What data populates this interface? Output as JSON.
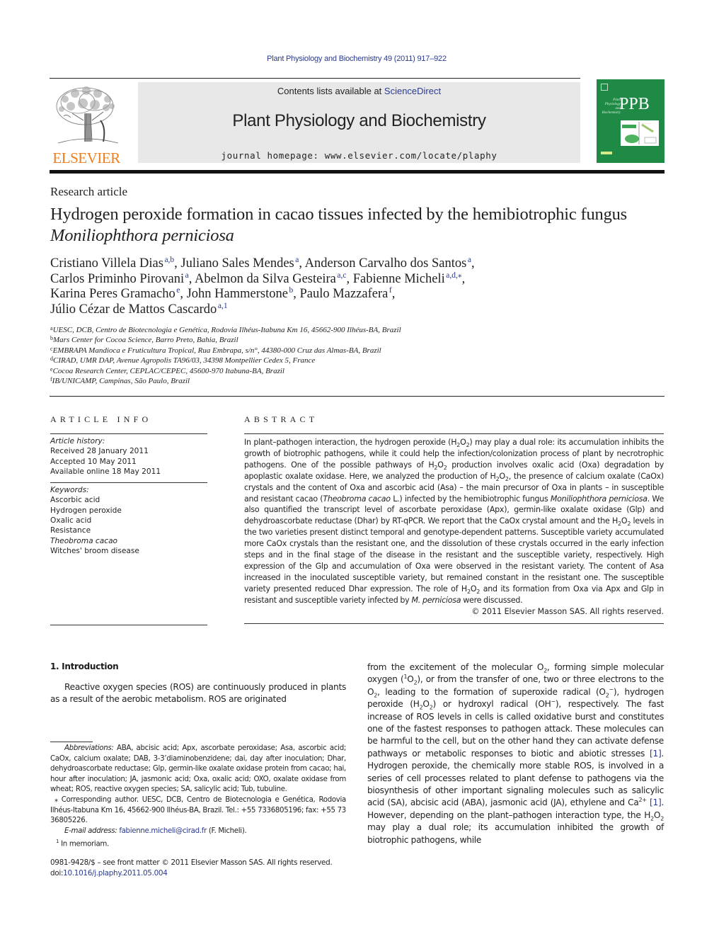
{
  "header": {
    "citation": "Plant Physiology and Biochemistry 49 (2011) 917–922",
    "contents_prefix": "Contents lists available at ",
    "contents_link": "ScienceDirect",
    "journal_title": "Plant Physiology and Biochemistry",
    "homepage": "journal homepage: www.elsevier.com/locate/plaphy",
    "publisher_logo_text": "ELSEVIER",
    "cover_abbrev": "PPB",
    "cover_small_title": "Plant Physiology and Biochemistry",
    "colors": {
      "elsevier_orange": "#f07d1b",
      "cover_green": "#1e8a45",
      "link_blue": "#2b3a8f",
      "banner_gray": "#e8e8e8"
    }
  },
  "article": {
    "type": "Research article",
    "title_plain": "Hydrogen peroxide formation in cacao tissues infected by the hemibiotrophic fungus ",
    "title_italic": "Moniliophthora perniciosa",
    "authors": [
      {
        "name": "Cristiano Villela Dias",
        "sup": "a,b",
        "sep": ", "
      },
      {
        "name": "Juliano Sales Mendes",
        "sup": "a",
        "sep": ", "
      },
      {
        "name": "Anderson Carvalho dos Santos",
        "sup": "a",
        "sep": ","
      },
      {
        "name": "Carlos Priminho Pirovani",
        "sup": "a",
        "sep": ", "
      },
      {
        "name": "Abelmon da Silva Gesteira",
        "sup": "a,c",
        "sep": ", "
      },
      {
        "name": "Fabienne Micheli",
        "sup": "a,d,⁎",
        "sep": ","
      },
      {
        "name": "Karina Peres Gramacho",
        "sup": "e",
        "sep": ", "
      },
      {
        "name": "John Hammerstone",
        "sup": "b",
        "sep": ", "
      },
      {
        "name": "Paulo Mazzafera",
        "sup": "f",
        "sep": ","
      },
      {
        "name": "Júlio Cézar de Mattos Cascardo",
        "sup": "a,1",
        "sep": ""
      }
    ],
    "affiliations": [
      {
        "key": "a",
        "text": "UESC, DCB, Centro de Biotecnologia e Genética, Rodovia Ilhéus-Itabuna Km 16, 45662-900 Ilhéus-BA, Brazil"
      },
      {
        "key": "b",
        "text": "Mars Center for Cocoa Science, Barro Preto, Bahia, Brazil"
      },
      {
        "key": "c",
        "text": "EMBRAPA Mandioca e Fruticultura Tropical, Rua Embrapa, s/n°, 44380-000 Cruz das Almas-BA, Brazil"
      },
      {
        "key": "d",
        "text": "CIRAD, UMR DAP, Avenue Agropolis TA96/03, 34398 Montpellier Cedex 5, France"
      },
      {
        "key": "e",
        "text": "Cocoa Research Center, CEPLAC/CEPEC, 45600-970 Itabuna-BA, Brazil"
      },
      {
        "key": "f",
        "text": "IB/UNICAMP, Campinas, São Paulo, Brazil"
      }
    ]
  },
  "article_info": {
    "heading": "ARTICLE INFO",
    "history_label": "Article history:",
    "history": [
      "Received 28 January 2011",
      "Accepted 10 May 2011",
      "Available online 18 May 2011"
    ],
    "keywords_label": "Keywords:",
    "keywords": [
      "Ascorbic acid",
      "Hydrogen peroxide",
      "Oxalic acid",
      "Resistance",
      "Theobroma cacao",
      "Witches' broom disease"
    ]
  },
  "abstract": {
    "heading": "ABSTRACT",
    "p1": "In plant–pathogen interaction, the hydrogen peroxide (H",
    "p2": ") may play a dual role: its accumulation inhibits the growth of biotrophic pathogens, while it could help the infection/colonization process of plant by necrotrophic pathogens. One of the possible pathways of H",
    "p3": " production involves oxalic acid (Oxa) degradation by apoplastic oxalate oxidase. Here, we analyzed the production of H",
    "p4": ", the presence of calcium oxalate (CaOx) crystals and the content of Oxa and ascorbic acid (Asa) – the main precursor of Oxa in plants – in susceptible and resistant cacao (",
    "species1": "Theobroma cacao",
    "p5": " L.) infected by the hemibiotrophic fungus ",
    "species2": "Moniliophthora perniciosa",
    "p6": ". We also quantified the transcript level of ascorbate peroxidase (Apx), germin-like oxalate oxidase (Glp) and dehydroascorbate reductase (Dhar) by RT-qPCR. We report that the CaOx crystal amount and the H",
    "p7": " levels in the two varieties present distinct temporal and genotype-dependent patterns. Susceptible variety accumulated more CaOx crystals than the resistant one, and the dissolution of these crystals occurred in the early infection steps and in the final stage of the disease in the resistant and the susceptible variety, respectively. High expression of the Glp and accumulation of Oxa were observed in the resistant variety. The content of Asa increased in the inoculated susceptible variety, but remained constant in the resistant one. The susceptible variety presented reduced Dhar expression. The role of H",
    "p8": " and its formation from Oxa via Apx and Glp in resistant and susceptible variety infected by ",
    "species3": "M. perniciosa",
    "p9": " were discussed.",
    "copyright": "© 2011 Elsevier Masson SAS. All rights reserved."
  },
  "introduction": {
    "heading": "1.  Introduction",
    "left_para": "Reactive oxygen species (ROS) are continuously produced in plants as a result of the aerobic metabolism. ROS are originated",
    "r1": "from the excitement of the molecular O",
    "r2": ", forming simple molecular oxygen (",
    "r3": "O",
    "r4": "), or from the transfer of one, two or three electrons to the O",
    "r5": ", leading to the formation of superoxide radical (O",
    "r6": "), hydrogen peroxide (H",
    "r7": ") or hydroxyl radical (OH",
    "r8": "), respectively. The fast increase of ROS levels in cells is called oxidative burst and constitutes one of the fastest responses to pathogen attack. These molecules can be harmful to the cell, but on the other hand they can activate defense pathways or metabolic responses to biotic and abiotic stresses ",
    "ref1": "[1]",
    "r9": ". Hydrogen peroxide, the chemically more stable ROS, is involved in a series of cell processes related to plant defense to pathogens via the biosynthesis of other important signaling molecules such as salicylic acid (SA), abcisic acid (ABA), jasmonic acid (JA), ethylene and Ca",
    "r10": " ",
    "ref2": "[1]",
    "r11": ". However, depending on the plant–pathogen interaction type, the H",
    "r12": " may play a dual role; its accumulation inhibited the growth of biotrophic pathogens, while"
  },
  "footnotes": {
    "abbrev_label": "Abbreviations:",
    "abbrev_text": " ABA, abcisic acid; Apx, ascorbate peroxidase; Asa, ascorbic acid; CaOx, calcium oxalate; DAB, 3-3’diaminobenzidene; dai, day after inoculation; Dhar, dehydroascorbate reductase; Glp, germin-like oxalate oxidase protein from cacao; hai, hour after inoculation; JA, jasmonic acid; Oxa, oxalic acid; OXO, oxalate oxidase from wheat; ROS, reactive oxygen species; SA, salicylic acid; Tub, tubuline.",
    "corresponding": "⁎ Corresponding author. UESC, DCB, Centro de Biotecnologia e Genética, Rodovia Ilhéus-Itabuna Km 16, 45662-900 Ilhéus-BA, Brazil. Tel.: +55 7336805196; fax: +55 73 36805226.",
    "email_label": "E-mail address:",
    "email": "fabienne.micheli@cirad.fr",
    "email_suffix": " (F. Micheli).",
    "memoriam_mark": "1",
    "memoriam": " In memoriam."
  },
  "front_matter": {
    "issn_line": "0981-9428/$ – see front matter © 2011 Elsevier Masson SAS. All rights reserved.",
    "doi_prefix": "doi:",
    "doi": "10.1016/j.plaphy.2011.05.004"
  },
  "chem": {
    "two": "2",
    "one": "1",
    "minus": "−",
    "two_plus": "2+",
    "O": "O"
  }
}
